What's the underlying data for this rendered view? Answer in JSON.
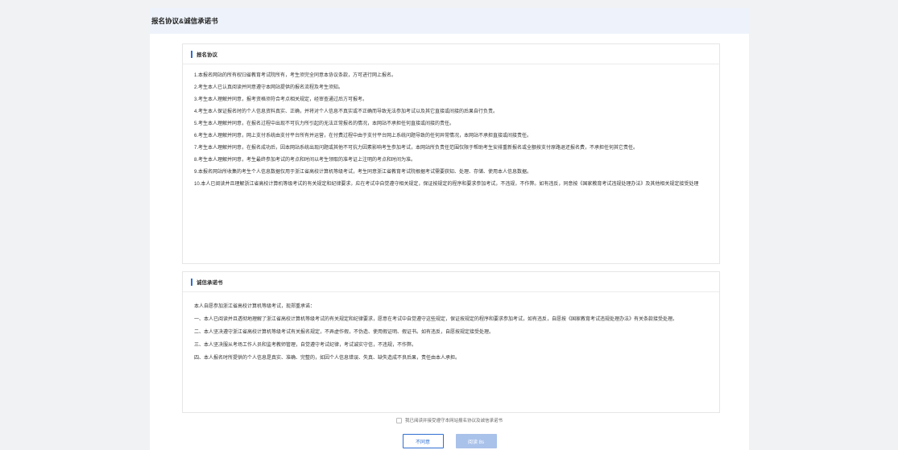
{
  "header": {
    "title": "报名协议&诚信承诺书"
  },
  "agreement": {
    "title": "报名协议",
    "items": [
      "1.本报名网站的所有权归省教育考试院所有，考生须完全同意本协议条款，方可进行网上报名。",
      "2.考生本人已认真阅读并同意遵守本网站提供的报名流程及考生须知。",
      "3.考生本人理解并同意，报考资格须符合考点相关规定，经审查通过后方可报考。",
      "4.考生本人保证报名时的个人信息资料真实、正确，并将对个人信息不真实或不正确而导致无法参加考试以及其它直接或间接的后果自行负责。",
      "5.考生本人理解并同意，在报名过程中出现不可抗力所引起的无法正常报名的情况，本网站不承担任何直接或间接的责任。",
      "6.考生本人理解并同意，网上支付系统由支付平台所有并运营，在付费过程中由于支付平台网上系统问题导致的任何异常情况，本网站不承担直接或间接责任。",
      "7.考生本人理解并同意，在报名成功后，因本网站系统出现问题或其他不可抗力因素影响考生参加考试，本网站所负责任范围仅限于帮助考生安排重新报名或全额按支付原路退还报名费，不承担任何其它责任。",
      "8.考生本人理解并同意，考生最终参加考试的考点和时间以考生领取的准考证上注明的考点和时间为准。",
      "9.本报名网站所收集的考生个人信息数据仅用于浙江省高校计算机等级考试，考生同意浙江省教育考试院根据考试需要获知、处理、存储、使用本人信息数据。",
      "10.本人已阅读并且理解浙江省高校计算机等级考试的有关规定和纪律要求，应在考试中自觉遵守相关规定，保证按规定的程序和要求参加考试，不违规，不作弊。如有违反，同意按《国家教育考试违规处理办法》及其他相关规定接受处理"
    ]
  },
  "commitment": {
    "title": "诚信承诺书",
    "items": [
      "本人自愿参加浙江省高校计算机等级考试，现郑重承诺：",
      "一、本人已阅读并且透彻地理解了浙江省高校计算机等级考试的有关规定和纪律要求，愿意在考试中自觉遵守这些规定，保证按规定的程序和要求参加考试，如有违反，自愿按《国家教育考试违规处理办法》有关条款接受处理。",
      "二、本人坚决遵守浙江省高校计算机等级考试有关报名规定，不弄虚作假，不伪造、使用假证明、假证书。如有违反，自愿按规定接受处理。",
      "三、本人坚决服从考场工作人员和监考教师管理，自觉遵守考试纪律，考试诚实守信，不违规，不作弊。",
      "四、本人报名时所提供的个人信息是真实、准确、完整的，如因个人信息错误、失真、缺失造成不良后果，责任由本人承担。"
    ]
  },
  "footer": {
    "checkbox_label": "我已阅读并接受遵守本网站报名协议及诚信承诺书",
    "disagree_label": "不同意",
    "read_label": "阅读 8s"
  },
  "colors": {
    "accent": "#2f6fd1",
    "disabled_button": "#a9c2ea",
    "header_bg": "#eef3fb"
  }
}
